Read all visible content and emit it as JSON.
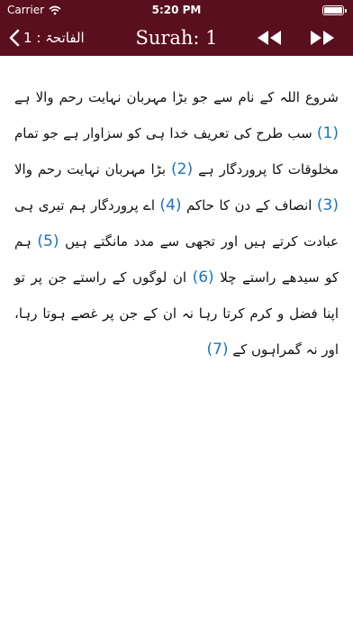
{
  "status_bar": {
    "carrier": "Carrier",
    "time": "5:20 PM"
  },
  "nav": {
    "back_label": "الفاتحۃ : 1",
    "title": "Surah: 1"
  },
  "verses": [
    {
      "text": "شروع اللہ کے نام سے جو بڑا مہربان نہایت رحم والا ہے",
      "number": "(1)"
    },
    {
      "text": "سب طرح کی تعریف خدا ہی کو سزاوار ہے جو تمام مخلوقات کا پروردگار ہے",
      "number": "(2)"
    },
    {
      "text": "بڑا مہربان نہایت رحم والا",
      "number": "(3)"
    },
    {
      "text": "انصاف کے دن کا حاکم",
      "number": "(4)"
    },
    {
      "text": "اے پروردگار ہم تیری ہی عبادت کرتے ہیں اور تجھی سے مدد مانگتے ہیں",
      "number": "(5)"
    },
    {
      "text": "ہم کو سیدھے راستے چلا",
      "number": "(6)"
    },
    {
      "text": "ان لوگوں کے راستے جن پر تو اپنا فضل و کرم کرتا رہا نہ ان کے جن پر غصے ہوتا رہا، اور نہ گمراہوں کے",
      "number": "(7)"
    }
  ]
}
